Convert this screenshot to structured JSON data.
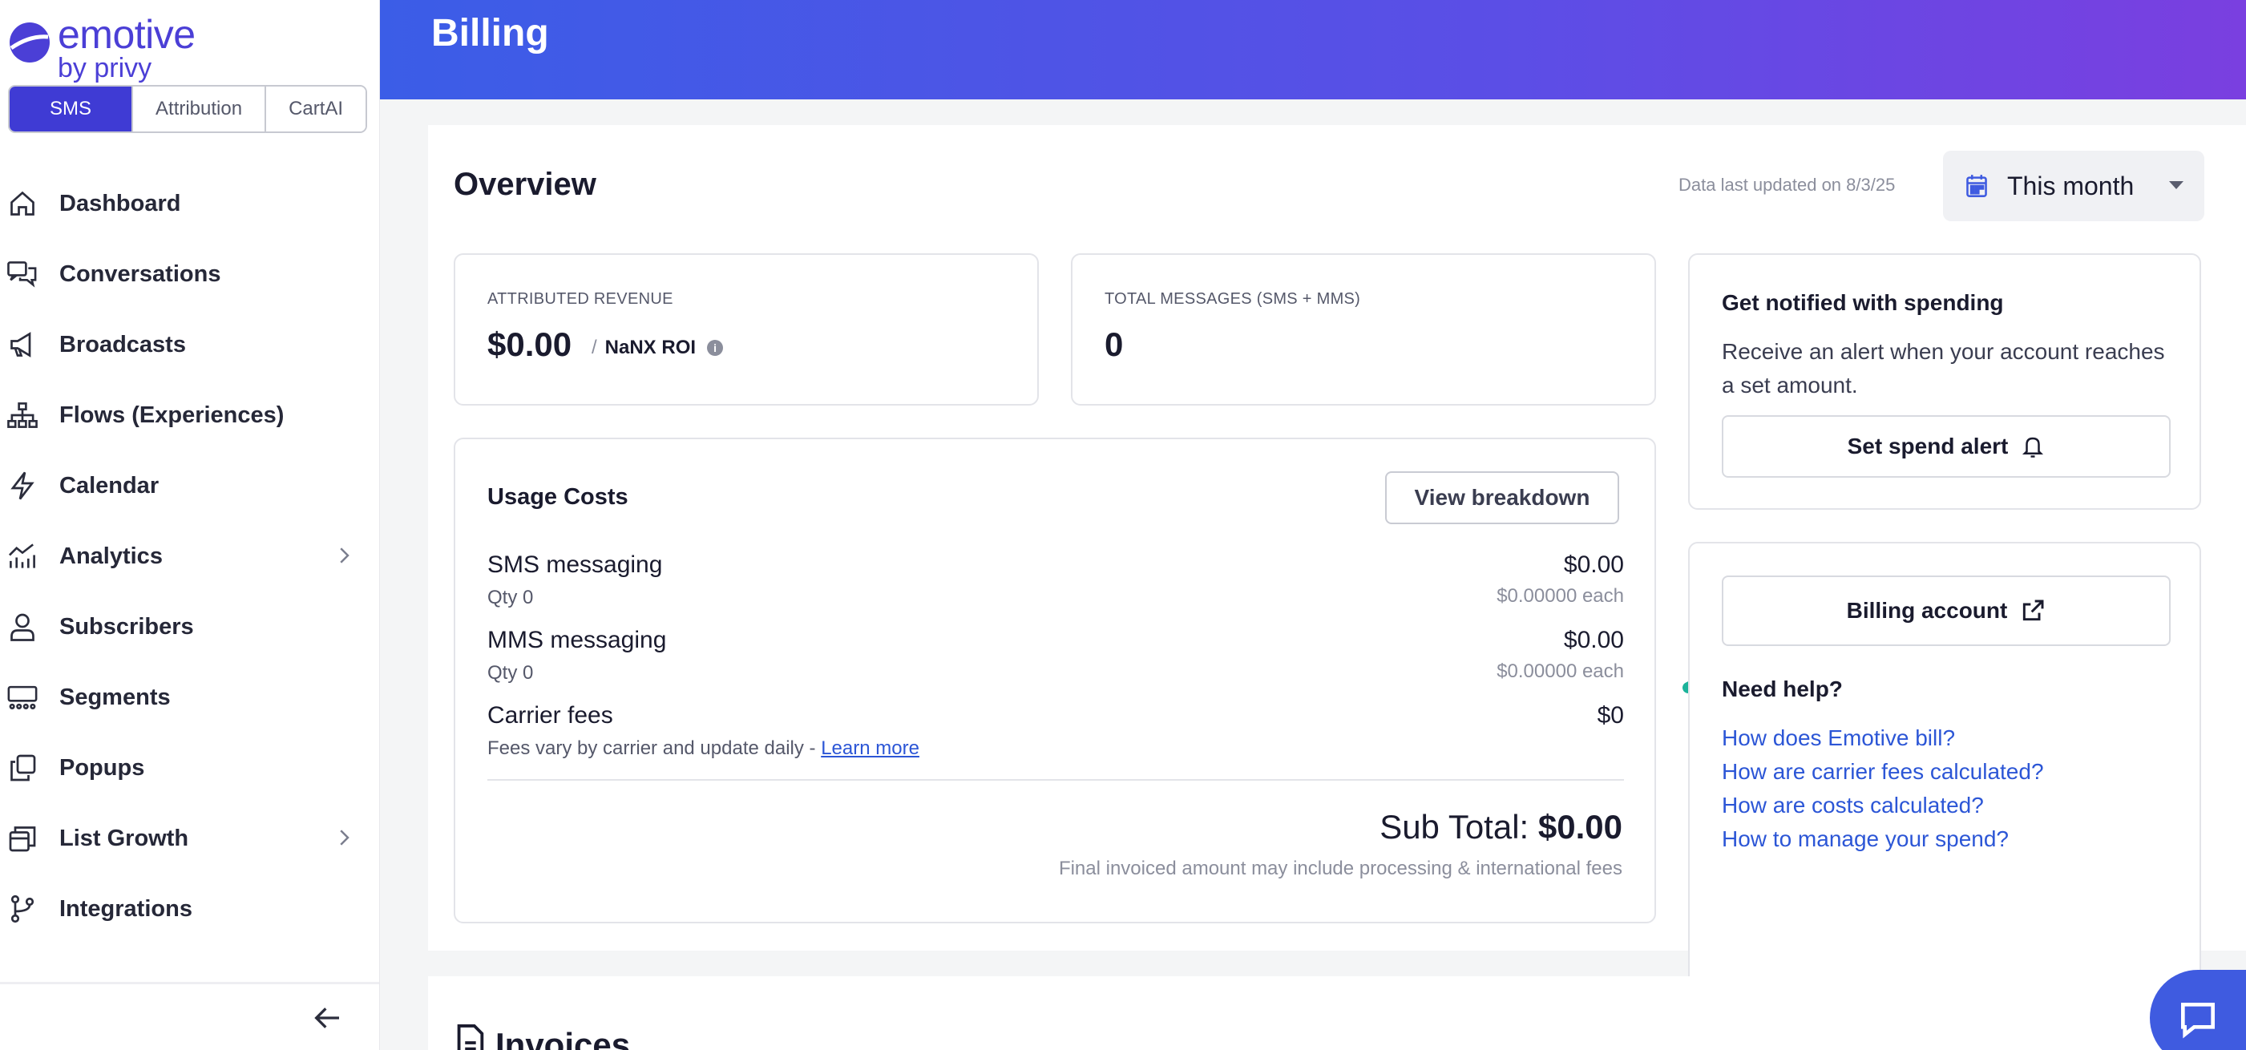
{
  "sidebar": {
    "logo": {
      "line1": "emotive",
      "line2": "by privy"
    },
    "product_tabs": [
      "SMS",
      "Attribution",
      "CartAI"
    ],
    "items": [
      {
        "label": "Dashboard",
        "icon": "home-icon"
      },
      {
        "label": "Conversations",
        "icon": "chat-icon"
      },
      {
        "label": "Broadcasts",
        "icon": "megaphone-icon"
      },
      {
        "label": "Flows (Experiences)",
        "icon": "flow-icon"
      },
      {
        "label": "Calendar",
        "icon": "lightning-icon"
      },
      {
        "label": "Analytics",
        "icon": "chart-icon",
        "has_submenu": true
      },
      {
        "label": "Subscribers",
        "icon": "person-icon"
      },
      {
        "label": "Segments",
        "icon": "segments-icon"
      },
      {
        "label": "Popups",
        "icon": "popups-icon"
      },
      {
        "label": "List Growth",
        "icon": "list-growth-icon",
        "has_submenu": true
      },
      {
        "label": "Integrations",
        "icon": "branch-icon"
      }
    ],
    "collapse_icon": "arrow-left-icon"
  },
  "header": {
    "title": "Billing"
  },
  "overview": {
    "title": "Overview",
    "updated": "Data last updated on 8/3/25",
    "range": "This month"
  },
  "metrics": {
    "revenue_label": "ATTRIBUTED REVENUE",
    "revenue_value": "$0.00",
    "roi_slash": "/",
    "roi": "NaNX ROI",
    "messages_label": "TOTAL MESSAGES (SMS + MMS)",
    "messages_value": "0"
  },
  "usage": {
    "title": "Usage Costs",
    "breakdown_button": "View breakdown",
    "items": [
      {
        "name": "SMS messaging",
        "sub": "Qty 0",
        "price": "$0.00",
        "each": "$0.00000 each"
      },
      {
        "name": "MMS messaging",
        "sub": "Qty 0",
        "price": "$0.00",
        "each": "$0.00000 each"
      },
      {
        "name": "Carrier fees",
        "sub": "Fees vary by carrier and update daily - ",
        "price": "$0",
        "link": "Learn more"
      }
    ],
    "subtotal_label": "Sub Total: ",
    "subtotal_value": "$0.00",
    "final_note": "Final invoiced amount may include processing & international fees"
  },
  "alert": {
    "title": "Get notified with spending",
    "desc": "Receive an alert when your account reaches a set amount.",
    "button": "Set spend alert"
  },
  "billing": {
    "button": "Billing account",
    "help_title": "Need help?",
    "links": [
      "How does Emotive bill?",
      "How are carrier fees calculated?",
      "How are costs calculated?",
      "How to manage your spend?"
    ]
  },
  "invoices": {
    "title": "Invoices"
  },
  "colors": {
    "brand": "#3f3bd4",
    "link": "#2c56d6",
    "annotation": "#1bb39a"
  }
}
